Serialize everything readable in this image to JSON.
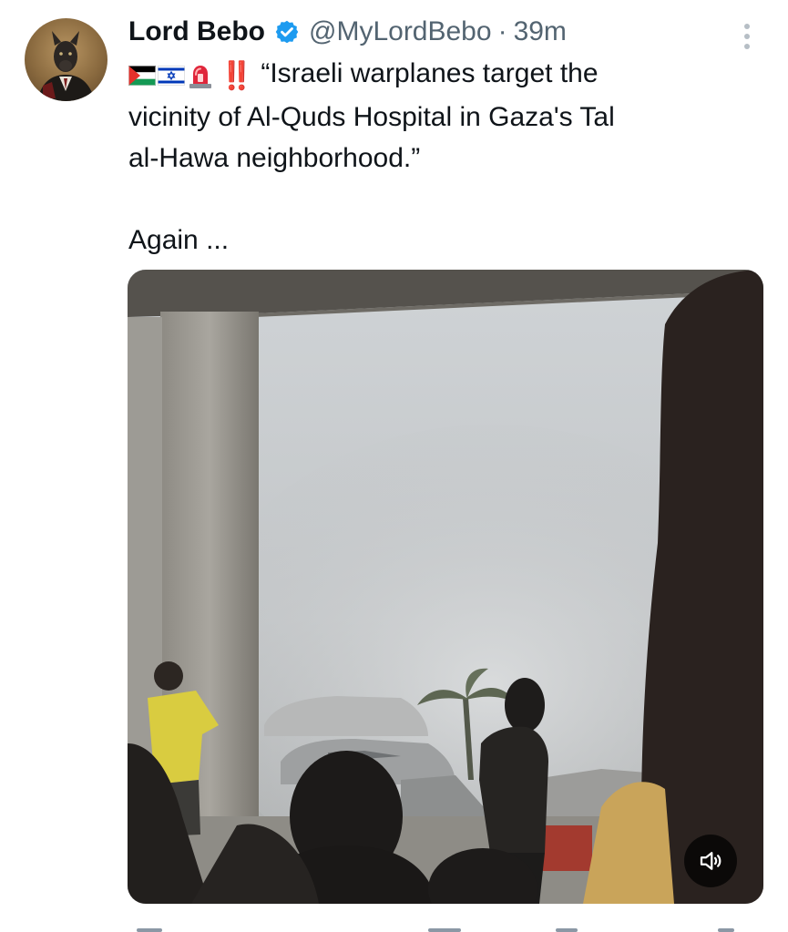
{
  "tweet": {
    "author": {
      "display_name": "Lord Bebo",
      "verified": true,
      "handle": "@MyLordBebo",
      "separator": "·",
      "time_ago": "39m"
    },
    "text": {
      "emojis": [
        "palestine-flag",
        "israel-flag",
        "police-light-emoji"
      ],
      "exclamation": "‼️",
      "line1": "“Israeli warplanes target the",
      "line2": "vicinity of Al-Quds Hospital in Gaza's Tal",
      "line3": "al-Hawa neighborhood.”",
      "line4": "Again ..."
    },
    "media": {
      "type": "video",
      "volume_icon": "volume-muted-icon"
    }
  },
  "colors": {
    "text_primary": "#0f1419",
    "text_secondary": "#536471",
    "verified_blue": "#1d9bf0",
    "exclamation_red": "#e0263b"
  }
}
